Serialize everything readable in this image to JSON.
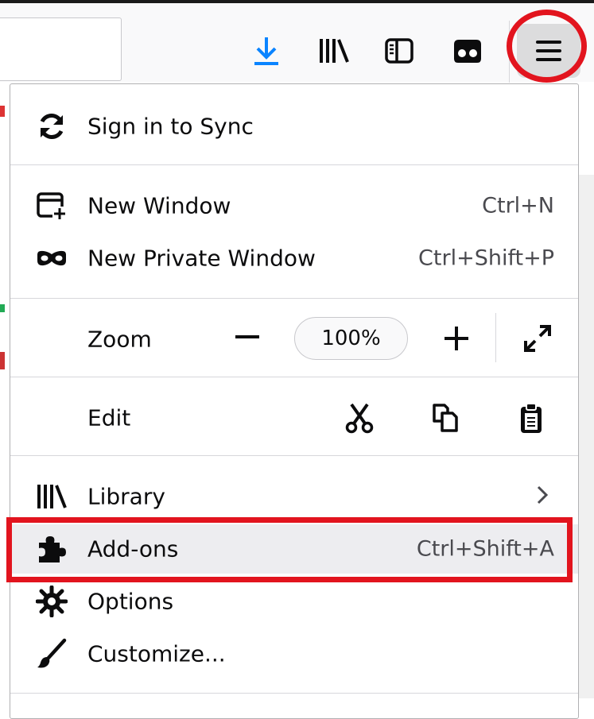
{
  "toolbar": {
    "icons": [
      "download-icon",
      "library-icon",
      "sidebar-icon",
      "extension-icon",
      "hamburger-menu-icon"
    ],
    "colors": {
      "download": "#0a84ff",
      "annotation": "#e2141e"
    }
  },
  "menu": {
    "sync": {
      "label": "Sign in to Sync"
    },
    "new_window": {
      "label": "New Window",
      "shortcut": "Ctrl+N"
    },
    "new_private_window": {
      "label": "New Private Window",
      "shortcut": "Ctrl+Shift+P"
    },
    "zoom": {
      "label": "Zoom",
      "value": "100%"
    },
    "edit": {
      "label": "Edit"
    },
    "library": {
      "label": "Library"
    },
    "addons": {
      "label": "Add-ons",
      "shortcut": "Ctrl+Shift+A"
    },
    "options": {
      "label": "Options"
    },
    "customize": {
      "label": "Customize..."
    }
  }
}
